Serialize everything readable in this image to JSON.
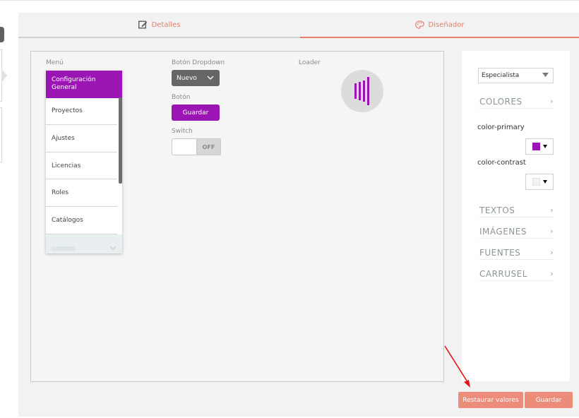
{
  "tabs": {
    "details": {
      "label": "Detalles",
      "icon": "edit-icon"
    },
    "designer": {
      "label": "Diseñador",
      "icon": "palette-icon"
    }
  },
  "preview": {
    "menu_label": "Menú",
    "menu_items": [
      "Configuración General",
      "Proyectos",
      "Ajustes",
      "Licencias",
      "Roles",
      "Catálogos"
    ],
    "dropdown_label": "Botón Dropdown",
    "dropdown_value": "Nuevo",
    "button_label": "Botón",
    "button_text": "Guardar",
    "switch_label": "Switch",
    "switch_state": "OFF",
    "loader_label": "Loader"
  },
  "settings": {
    "profile_select": "Especialista",
    "sections": {
      "colores": "COLORES",
      "textos": "TEXTOS",
      "imagenes": "IMÁGENES",
      "fuentes": "FUENTES",
      "carrusel": "CARRUSEL"
    },
    "color_primary_label": "color-primary",
    "color_primary_value": "#9b15b5",
    "color_contrast_label": "color-contrast",
    "color_contrast_value": "#f2f2f2"
  },
  "footer": {
    "restore_label": "Restaurar valores",
    "save_label": "Guardar"
  },
  "colors": {
    "accent": "#e97f6a",
    "primary": "#9b15b5",
    "annotation_arrow": "#e01616"
  }
}
